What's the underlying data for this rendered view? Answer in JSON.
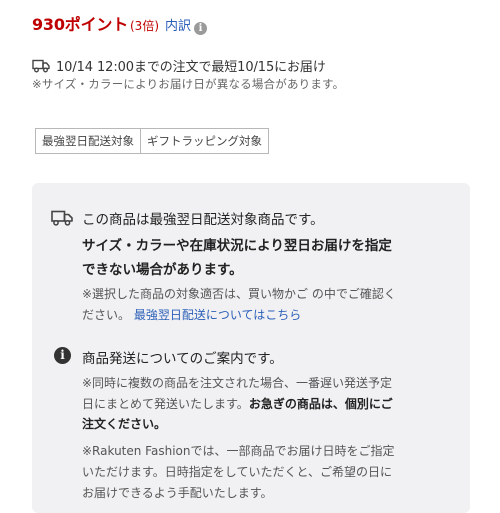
{
  "points": {
    "amount": "930ポイント",
    "multiplier": "(3倍)",
    "breakdown_label": "内訳"
  },
  "delivery": {
    "text": "10/14 12:00までの注文で最短10/15にお届け",
    "note": "※サイズ・カラーによりお届け日が異なる場合があります。"
  },
  "tags": [
    "最強翌日配送対象",
    "ギフトラッピング対象"
  ],
  "panel": {
    "next_day": {
      "title": "この商品は最強翌日配送対象商品です。",
      "warning_line1": "サイズ・カラーや在庫状況により翌日お届けを指定",
      "warning_line2": "できない場合があります。",
      "note_line1": "※選択した商品の対象適否は、買い物かご の中でご確認く",
      "note_line2_prefix": "ださい。",
      "link_text": "最強翌日配送についてはこちら"
    },
    "shipping_info": {
      "title": "商品発送についてのご案内です。",
      "para1_line1": "※同時に複数の商品を注文された場合、一番遅い発送予定",
      "para1_line2_plain": "日にまとめて発送いたします。",
      "para1_line2_bold": "お急ぎの商品は、個別にご",
      "para1_line3_bold": "注文ください。",
      "para2_line1": "※Rakuten Fashionでは、一部商品でお届け日時をご指定",
      "para2_line2": "いただけます。日時指定をしていただくと、ご希望の日に",
      "para2_line3": "お届けできるよう手配いたします。"
    }
  },
  "colors": {
    "points_red": "#bf0000",
    "link_blue": "#2a5fb8",
    "panel_bg": "#f1f1f3"
  }
}
